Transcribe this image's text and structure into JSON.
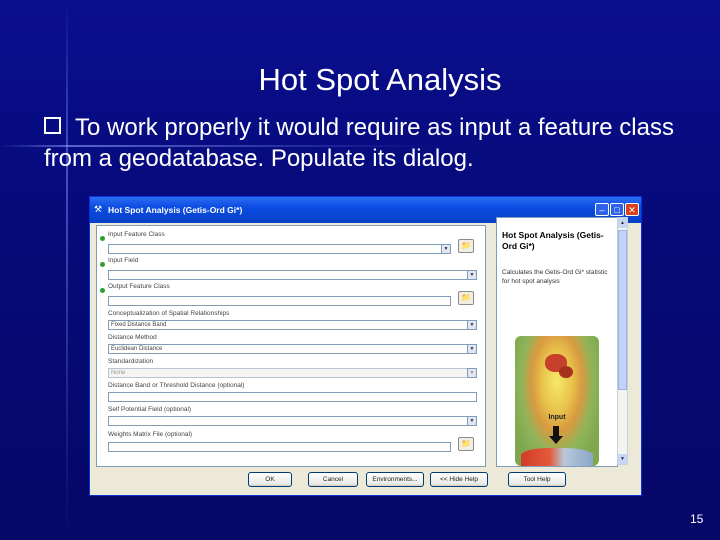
{
  "slide": {
    "title": "Hot Spot Analysis",
    "bullet": "To work properly it would require as input a feature class from a geodatabase. Populate its dialog.",
    "page_number": "15"
  },
  "dialog": {
    "title": "Hot Spot Analysis (Getis-Ord Gi*)",
    "fields": [
      {
        "label": "Input Feature Class",
        "value": "",
        "required": true
      },
      {
        "label": "Input Field",
        "value": "",
        "required": true
      },
      {
        "label": "Output Feature Class",
        "value": "",
        "required": true
      },
      {
        "label": "Conceptualization of Spatial Relationships",
        "value": "Fixed Distance Band"
      },
      {
        "label": "Distance Method",
        "value": "Euclidean Distance"
      },
      {
        "label": "Standardization",
        "value": "None"
      },
      {
        "label": "Distance Band or Threshold Distance (optional)",
        "value": ""
      },
      {
        "label": "Self Potential Field (optional)",
        "value": ""
      },
      {
        "label": "Weights Matrix File (optional)",
        "value": ""
      }
    ],
    "help": {
      "title": "Hot Spot Analysis (Getis-Ord Gi*)",
      "description": "Calculates the Getis-Ord Gi* statistic for hot spot analysis",
      "image_label": "Input"
    },
    "buttons": {
      "ok": "OK",
      "cancel": "Cancel",
      "environments": "Environments...",
      "hide_help": "<< Hide Help",
      "tool_help": "Tool Help"
    },
    "colors": {
      "titlebar": "#0a4ce2",
      "required_dot": "#2ca02c",
      "slide_background": "#0a0f8f"
    }
  }
}
